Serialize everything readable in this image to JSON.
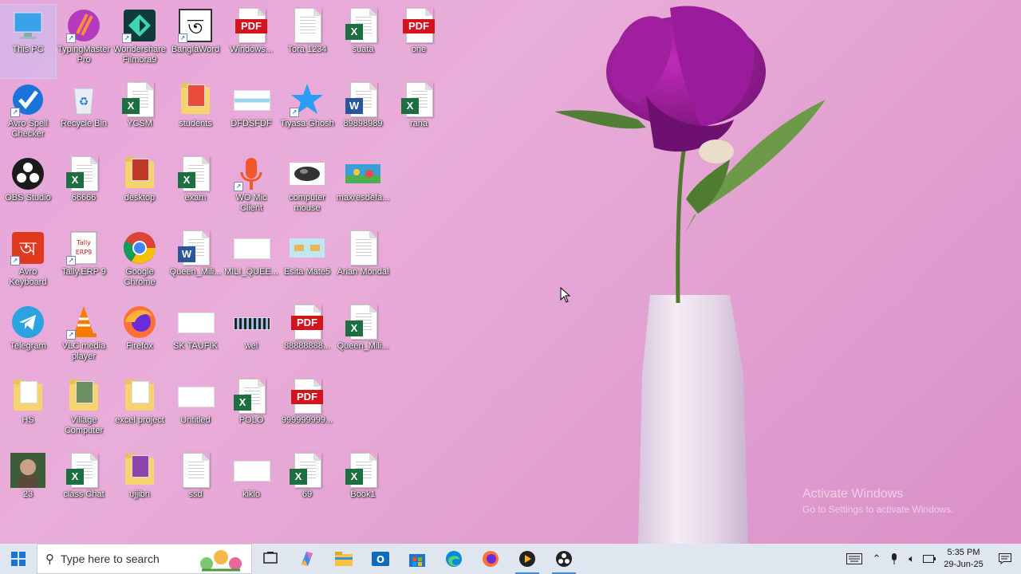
{
  "desktop": {
    "icons": [
      {
        "label": "This PC"
      },
      {
        "label": "TypingMaster Pro"
      },
      {
        "label": "Wondershare Filmora9"
      },
      {
        "label": "BanglaWord"
      },
      {
        "label": "Windows...",
        "type_text": "PDF"
      },
      {
        "label": "Tora 1234"
      },
      {
        "label": "suata"
      },
      {
        "label": "one",
        "type_text": "PDF"
      },
      {
        "label": "Avro Spell Checker"
      },
      {
        "label": "Recycle Bin"
      },
      {
        "label": "YCSM"
      },
      {
        "label": "students"
      },
      {
        "label": "DFDSFDF"
      },
      {
        "label": "Tiyasa Ghosh"
      },
      {
        "label": "89898989"
      },
      {
        "label": "rana"
      },
      {
        "label": "OBS Studio"
      },
      {
        "label": "66666"
      },
      {
        "label": "desktop"
      },
      {
        "label": "exam"
      },
      {
        "label": "WO Mic Client"
      },
      {
        "label": "computer mouse"
      },
      {
        "label": "maxresdefa..."
      },
      {
        "label": "Avro Keyboard"
      },
      {
        "label": "Tally.ERP 9"
      },
      {
        "label": "Google Chrome"
      },
      {
        "label": "Queen_Mili..."
      },
      {
        "label": "MILI_QUEE..."
      },
      {
        "label": "Esita Mate5"
      },
      {
        "label": "Arian Mondal"
      },
      {
        "label": "Telegram"
      },
      {
        "label": "VLC media player"
      },
      {
        "label": "Firefox"
      },
      {
        "label": "SK TAUFIK"
      },
      {
        "label": "wel"
      },
      {
        "label": "88888888...",
        "type_text": "PDF"
      },
      {
        "label": "Queen_Mili..."
      },
      {
        "label": "HS"
      },
      {
        "label": "Village Computer"
      },
      {
        "label": "excel project"
      },
      {
        "label": "Untitled"
      },
      {
        "label": "POLO"
      },
      {
        "label": "999999999...",
        "type_text": "PDF"
      },
      {
        "label": "23"
      },
      {
        "label": "class Chat"
      },
      {
        "label": "ujjibn"
      },
      {
        "label": "ssd"
      },
      {
        "label": "kiklo"
      },
      {
        "label": "69"
      },
      {
        "label": "Book1"
      }
    ],
    "watermark": {
      "line1": "Activate Windows",
      "line2": "Go to Settings to activate Windows."
    }
  },
  "taskbar": {
    "search_placeholder": "Type here to search",
    "clock_time": "5:35 PM",
    "clock_date": "29-Jun-25"
  },
  "colors": {
    "excel": "#1d6f42",
    "word": "#2b579a",
    "pdf": "#d4141c",
    "taskbar_bg": "#dfe6f0",
    "wallpaper": "#e6a6d9"
  }
}
